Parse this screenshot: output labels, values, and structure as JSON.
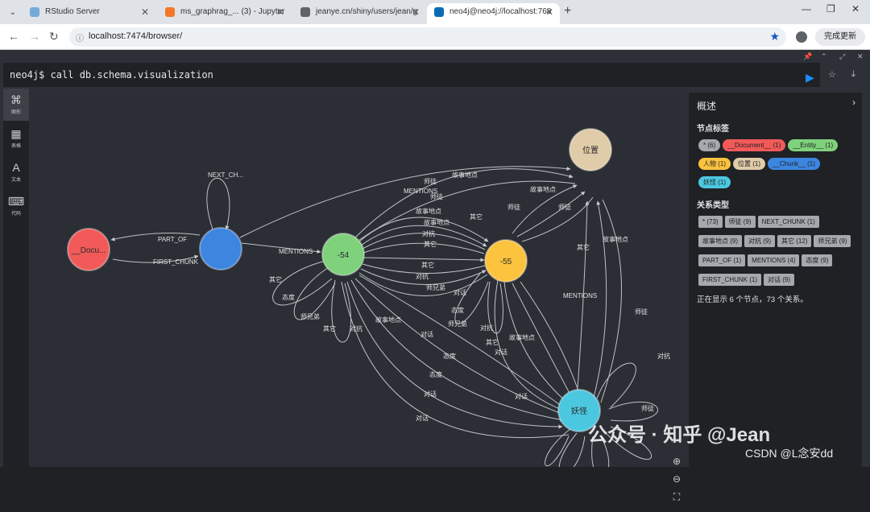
{
  "browser": {
    "tabs": [
      {
        "title": "RStudio Server",
        "favicon_color": "#75aadb",
        "active": false
      },
      {
        "title": "ms_graphrag_... (3) - Jupyter",
        "favicon_color": "#f37726",
        "active": false
      },
      {
        "title": "jeanye.cn/shiny/users/jean/g",
        "favicon_color": "#5f6368",
        "active": false
      },
      {
        "title": "neo4j@neo4j://localhost:768",
        "favicon_color": "#0a6db3",
        "active": true
      }
    ],
    "url": "localhost:7474/browser/",
    "update_button": "完成更新"
  },
  "editor": {
    "query": "neo4j$ call db.schema.visualization"
  },
  "sidebar": {
    "items": [
      {
        "label": "图形",
        "icon": "graph-icon"
      },
      {
        "label": "表格",
        "icon": "table-icon"
      },
      {
        "label": "文本",
        "icon": "text-icon"
      },
      {
        "label": "代码",
        "icon": "code-icon"
      }
    ]
  },
  "graph": {
    "nodes": [
      {
        "id": "doc",
        "label": "__Docu...",
        "color": "#f25a5a"
      },
      {
        "id": "chunk",
        "label": "",
        "color": "#3c86e0"
      },
      {
        "id": "n54",
        "label": "-54",
        "color": "#7fd17c"
      },
      {
        "id": "n55",
        "label": "-55",
        "color": "#fcc33e"
      },
      {
        "id": "loc",
        "label": "位置",
        "color": "#e0cca8"
      },
      {
        "id": "demon",
        "label": "妖怪",
        "color": "#4bc8e0"
      }
    ],
    "edge_labels": [
      "PART_OF",
      "FIRST_CHUNK",
      "NEXT_CH...",
      "MENTIONS",
      "师徒",
      "故事地点",
      "其它",
      "对抗",
      "师兄弟",
      "态度",
      "对话"
    ]
  },
  "overview": {
    "title": "概述",
    "node_labels_heading": "节点标签",
    "node_labels": [
      {
        "text": "* (6)",
        "color": "#a5a8ad"
      },
      {
        "text": "__Document__ (1)",
        "color": "#f25a5a"
      },
      {
        "text": "__Entity__ (1)",
        "color": "#7fd17c"
      },
      {
        "text": "人物 (1)",
        "color": "#fcc33e"
      },
      {
        "text": "位置 (1)",
        "color": "#e0cca8"
      },
      {
        "text": "__Chunk__ (1)",
        "color": "#3c86e0"
      },
      {
        "text": "妖怪 (1)",
        "color": "#4bc8e0"
      }
    ],
    "rel_types_heading": "关系类型",
    "rel_types": [
      "* (73)",
      "师徒 (9)",
      "NEXT_CHUNK (1)",
      "故事地点 (9)",
      "对抗 (9)",
      "其它 (12)",
      "师兄弟 (9)",
      "PART_OF (1)",
      "MENTIONS (4)",
      "态度 (9)",
      "FIRST_CHUNK (1)",
      "对话 (9)"
    ],
    "summary": "正在显示 6 个节点，73 个关系。"
  },
  "watermark": {
    "wechat": "公众号 · 知乎 @Jean",
    "csdn": "CSDN @L念安dd"
  }
}
